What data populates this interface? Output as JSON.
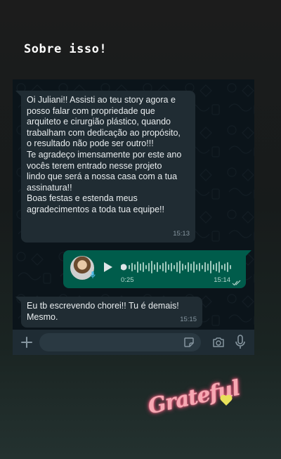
{
  "story": {
    "caption": "Sobre isso!",
    "sticker_text": "Grateful"
  },
  "messages": [
    {
      "direction": "incoming",
      "text": "Oi Juliani!! Assisti ao teu story agora e posso falar com propriedade que arquiteto e cirurgião plástico, quando trabalham com dedicação ao propósito, o resultado não pode ser outro!!!\nTe agradeço imensamente por este ano vocês terem entrado nesse projeto lindo que será a nossa casa com a tua assinatura!!\nBoas festas e estenda meus agradecimentos a toda tua equipe!!",
      "time": "15:13"
    },
    {
      "direction": "outgoing",
      "type": "voice",
      "duration": "0:25",
      "time": "15:14",
      "status": "read"
    },
    {
      "direction": "incoming",
      "text": "Eu tb escrevendo chorei!! Tu é demais! Mesmo.",
      "time": "15:15"
    }
  ],
  "input_bar": {
    "placeholder": "",
    "icons": [
      "plus-icon",
      "sticker-icon",
      "camera-icon",
      "mic-icon"
    ]
  },
  "colors": {
    "incoming_bubble": "#202c33",
    "outgoing_bubble": "#005c4b",
    "chat_background": "#0b141a",
    "sticker_pink": "#f6a9b3",
    "heart_yellow": "#e8e25a"
  }
}
